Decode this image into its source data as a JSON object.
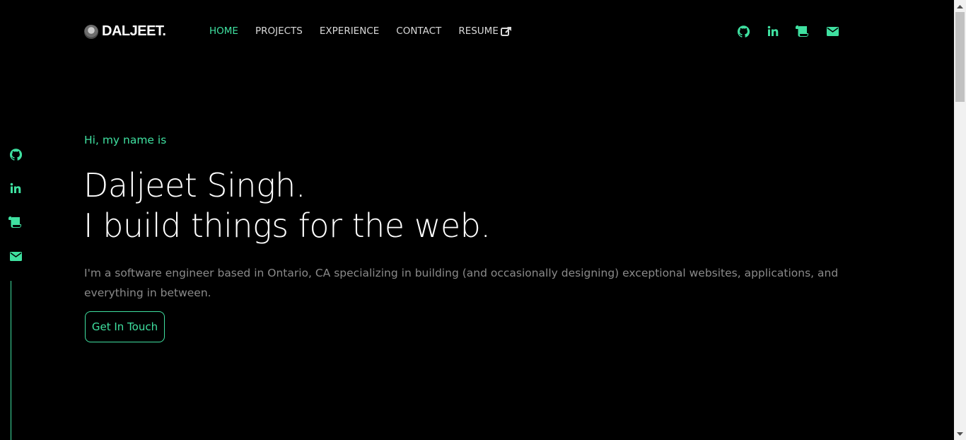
{
  "navbar": {
    "brand": "DALJEET.",
    "links": [
      {
        "label": "HOME",
        "active": true
      },
      {
        "label": "PROJECTS",
        "active": false
      },
      {
        "label": "EXPERIENCE",
        "active": false
      },
      {
        "label": "CONTACT",
        "active": false
      },
      {
        "label": "RESUME",
        "active": false,
        "icon": "external-link-icon"
      }
    ],
    "social_icons": [
      "github-icon",
      "linkedin-icon",
      "scroll-icon",
      "envelope-icon"
    ]
  },
  "side_social": {
    "icons": [
      "github-icon",
      "linkedin-icon",
      "scroll-icon",
      "envelope-icon"
    ]
  },
  "hero": {
    "greeting": "Hi, my name is",
    "title_line1": "Daljeet Singh.",
    "title_line2": "I build things for the web.",
    "description": "I'm a software engineer based in Ontario, CA specializing in building (and occasionally designing) exceptional websites, applications, and everything in between.",
    "cta_label": "Get In Touch"
  },
  "colors": {
    "background": "#000000",
    "accent": "#3fe0a0",
    "text": "#ffffff",
    "muted": "#8a8a8a"
  }
}
